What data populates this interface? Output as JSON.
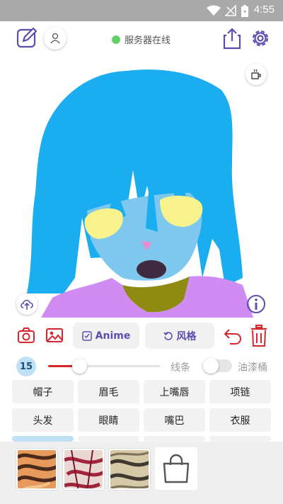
{
  "status_bar": {
    "time": "4:55"
  },
  "header": {
    "server_status": "服务器在线"
  },
  "toolbar": {
    "anime_label": "Anime",
    "style_label": "风格"
  },
  "brush": {
    "size": "15",
    "level": 0.28,
    "line_label": "线条",
    "bucket_label": "油漆桶",
    "bucket_enabled": false
  },
  "parts": [
    [
      "帽子",
      "眉毛",
      "上嘴唇",
      "项链"
    ],
    [
      "头发",
      "眼睛",
      "嘴巴",
      "衣服"
    ]
  ],
  "icons": {
    "edit": "edit-icon",
    "user": "user-icon",
    "share": "share-icon",
    "settings": "gear-icon",
    "coffee": "coffee-icon",
    "upload": "cloud-upload-icon",
    "info": "info-icon",
    "camera": "camera-icon",
    "gallery": "image-icon",
    "undo": "undo-icon",
    "delete": "trash-icon",
    "shop": "shopping-bag-icon"
  },
  "colors": {
    "accent": "#5a4fb0",
    "red": "#d8262c",
    "hair": "#1aaef0",
    "skin": "#7ec8ef",
    "eyes": "#f8f38c",
    "shirt": "#d08cf2",
    "collar": "#8f8b12"
  }
}
